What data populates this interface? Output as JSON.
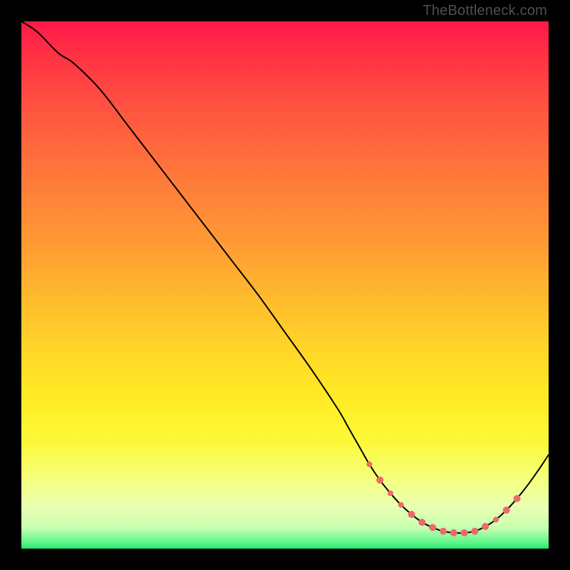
{
  "watermark": "TheBottleneck.com",
  "colors": {
    "marker": "#ed6a6a",
    "curve": "#000000",
    "gradient_top": "#ff1848",
    "gradient_mid": "#ffd528",
    "gradient_bottom": "#26e56d"
  },
  "chart_data": {
    "type": "line",
    "title": "",
    "xlabel": "",
    "ylabel": "",
    "xlim": [
      0,
      100
    ],
    "ylim": [
      0,
      100
    ],
    "grid": false,
    "series": [
      {
        "name": "curve",
        "x": [
          0,
          3,
          7,
          10,
          15,
          20,
          25,
          30,
          35,
          40,
          45,
          50,
          55,
          60,
          62,
          64,
          66,
          68,
          70,
          72,
          74,
          76,
          78,
          80,
          82,
          84,
          86,
          88,
          90,
          92,
          94,
          96,
          98,
          100
        ],
        "y": [
          100,
          98,
          94,
          92,
          87,
          80.5,
          74,
          67.5,
          61,
          54.5,
          48,
          41,
          34,
          26.5,
          23,
          19.5,
          16,
          13,
          10.5,
          8.3,
          6.5,
          5.0,
          4.0,
          3.3,
          3.0,
          3.0,
          3.3,
          4.2,
          5.5,
          7.3,
          9.5,
          12,
          14.8,
          17.8
        ]
      }
    ],
    "markers": {
      "name": "highlight-points",
      "color": "#ed6a6a",
      "x": [
        66,
        68,
        70,
        72,
        74,
        76,
        78,
        80,
        82,
        84,
        86,
        88,
        90,
        92,
        94
      ],
      "y": [
        16,
        13,
        10.5,
        8.3,
        6.5,
        5.0,
        4.0,
        3.3,
        3.0,
        3.0,
        3.3,
        4.2,
        5.5,
        7.3,
        9.5
      ],
      "radius": [
        4,
        5,
        4,
        4,
        5,
        5,
        5,
        5,
        5,
        5,
        5,
        5,
        4,
        5,
        5
      ]
    }
  }
}
